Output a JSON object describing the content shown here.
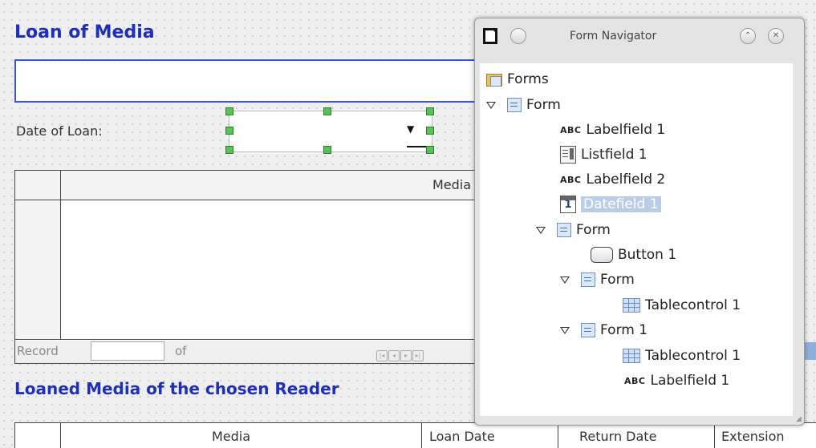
{
  "form": {
    "loan_heading": "Loan of Media",
    "date_label": "Date of Loan:",
    "table_header_media": "Media",
    "record_label": "Record",
    "of_label": "of",
    "loaned_heading": "Loaned Media of the chosen Reader",
    "bottom_columns": [
      "Media",
      "Loan Date",
      "Return Date",
      "Extension"
    ]
  },
  "navigator": {
    "title": "Form Navigator",
    "tree": [
      {
        "label": "Forms",
        "type": "forms"
      },
      {
        "label": "Form",
        "type": "form"
      },
      {
        "label": "Labelfield 1",
        "type": "label"
      },
      {
        "label": "Listfield 1",
        "type": "list"
      },
      {
        "label": "Labelfield 2",
        "type": "label"
      },
      {
        "label": "Datefield 1",
        "type": "date"
      },
      {
        "label": "Form",
        "type": "form"
      },
      {
        "label": "Button 1",
        "type": "button"
      },
      {
        "label": "Form",
        "type": "form"
      },
      {
        "label": "Tablecontrol 1",
        "type": "table"
      },
      {
        "label": "Form 1",
        "type": "form"
      },
      {
        "label": "Tablecontrol 1",
        "type": "table"
      },
      {
        "label": "Labelfield 1",
        "type": "label"
      }
    ]
  },
  "colors": {
    "heading": "#1f30b8",
    "selection": "#b9cde6",
    "handle": "#58c158"
  }
}
